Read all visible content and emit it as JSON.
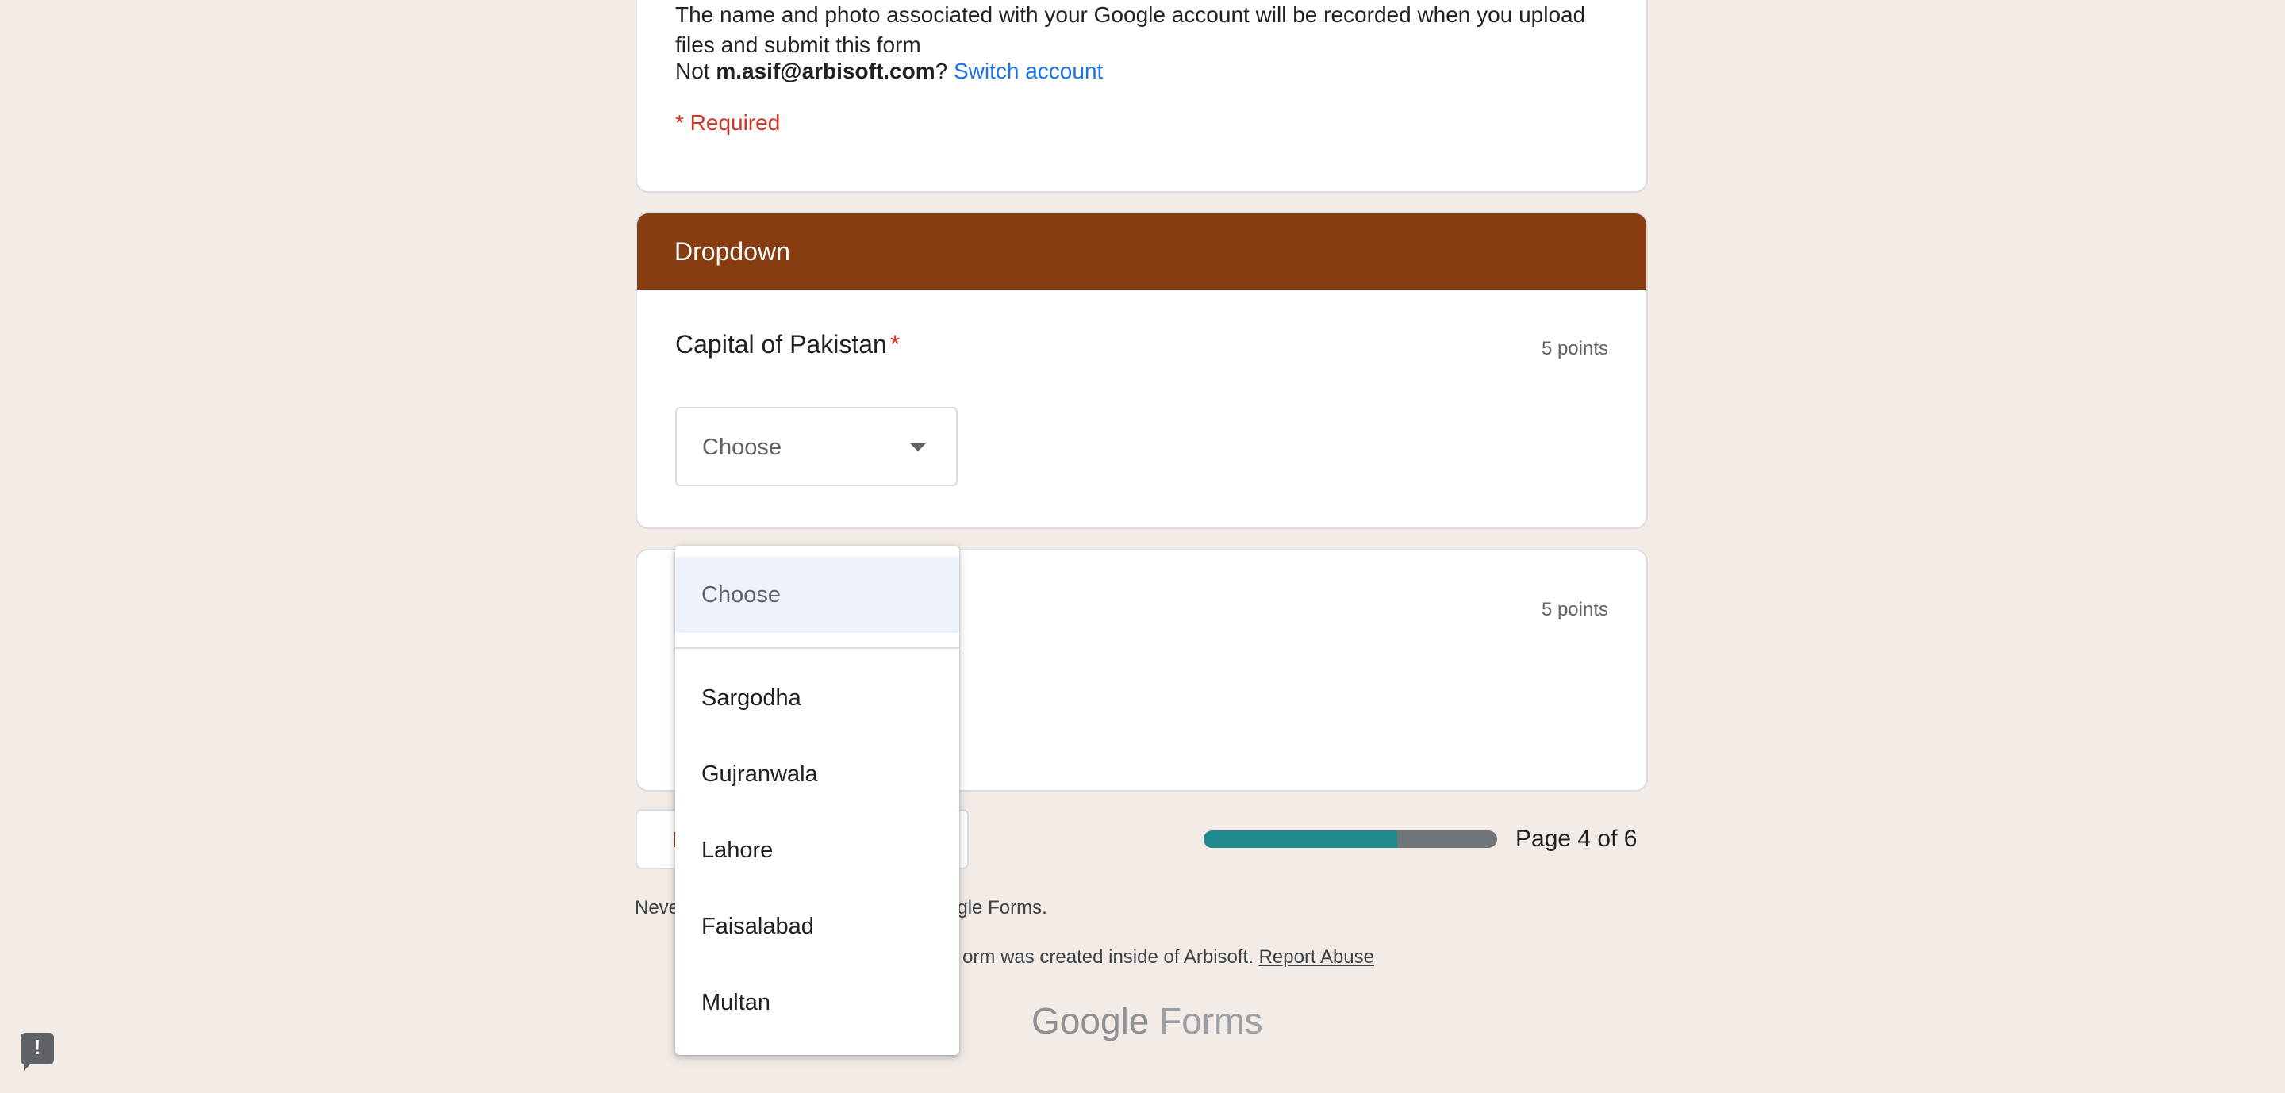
{
  "header": {
    "notice": "The name and photo associated with your Google account will be recorded when you upload files and submit this form",
    "not_prefix": "Not ",
    "account_email": "m.asif@arbisoft.com",
    "not_suffix": "? ",
    "switch_account": "Switch account",
    "required_note": "* Required"
  },
  "section": {
    "title": "Dropdown"
  },
  "question1": {
    "title": "Capital of Pakistan",
    "required_marker": "*",
    "points": "5 points",
    "dropdown_value": "Choose"
  },
  "question2": {
    "points": "5 points"
  },
  "dropdown_menu": {
    "placeholder": "Choose",
    "options": [
      "Sargodha",
      "Gujranwala",
      "Lahore",
      "Faisalabad",
      "Multan"
    ]
  },
  "navigation": {
    "back_label": "B",
    "progress_fraction": 0.66,
    "page_indicator": "Page 4 of 6"
  },
  "footer": {
    "never_text": "Neve",
    "never_text_tail": "ogle Forms.",
    "org_text": "orm was created inside of Arbisoft. ",
    "report_abuse": "Report Abuse",
    "logo_google": "Google",
    "logo_forms": "Forms"
  },
  "feedback": {
    "icon": "feedback-icon",
    "mark": "!"
  },
  "colors": {
    "background": "#f2ebe6",
    "section_header": "#873d10",
    "link": "#1a73e8",
    "required": "#d93025",
    "progress_fill": "#1e8a8f",
    "progress_track": "#70757a"
  }
}
